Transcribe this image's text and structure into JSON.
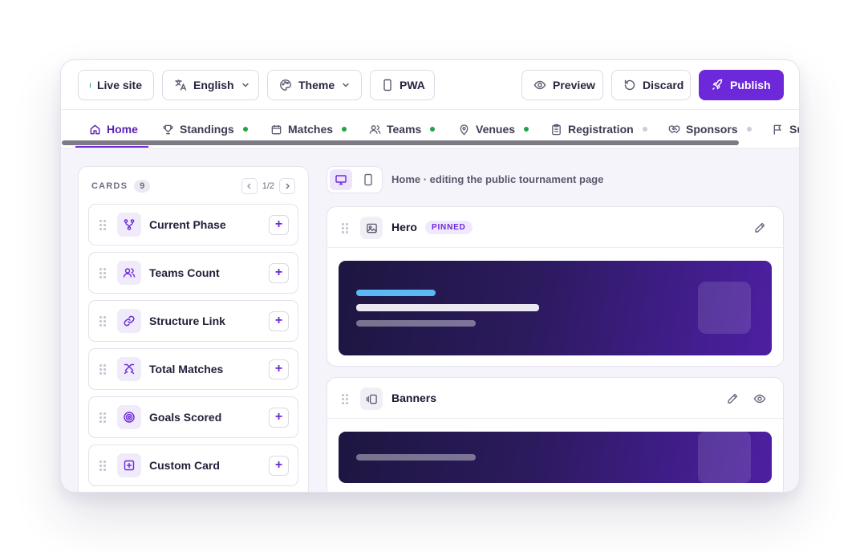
{
  "toolbar": {
    "live_site": "Live site",
    "language": "English",
    "theme": "Theme",
    "pwa": "PWA",
    "preview": "Preview",
    "discard": "Discard",
    "publish": "Publish"
  },
  "tabs": [
    {
      "label": "Home",
      "icon": "home-icon",
      "active": true
    },
    {
      "label": "Standings",
      "icon": "trophy-icon",
      "status": "green"
    },
    {
      "label": "Matches",
      "icon": "calendar-icon",
      "status": "green"
    },
    {
      "label": "Teams",
      "icon": "users-icon",
      "status": "green"
    },
    {
      "label": "Venues",
      "icon": "map-pin-icon",
      "status": "green"
    },
    {
      "label": "Registration",
      "icon": "clipboard-icon",
      "status": "grey"
    },
    {
      "label": "Sponsors",
      "icon": "handshake-icon",
      "status": "grey"
    },
    {
      "label": "Su",
      "icon": "flag-icon"
    }
  ],
  "cards_panel": {
    "title": "CARDS",
    "count": "9",
    "page": "1/2",
    "items": [
      {
        "label": "Current Phase",
        "icon": "branch-icon"
      },
      {
        "label": "Teams Count",
        "icon": "users-icon"
      },
      {
        "label": "Structure Link",
        "icon": "link-icon"
      },
      {
        "label": "Total Matches",
        "icon": "swords-icon"
      },
      {
        "label": "Goals Scored",
        "icon": "target-icon"
      },
      {
        "label": "Custom Card",
        "icon": "plus-square-icon"
      }
    ]
  },
  "editor": {
    "breadcrumb": "Home · editing the public tournament page",
    "sections": [
      {
        "title": "Hero",
        "badge": "PINNED",
        "icon": "image-icon"
      },
      {
        "title": "Banners",
        "icon": "carousel-icon"
      }
    ]
  },
  "colors": {
    "accent": "#6d28d9",
    "status_green": "#22a447",
    "banner_start": "#1d1640",
    "banner_end": "#4e1fa2"
  }
}
